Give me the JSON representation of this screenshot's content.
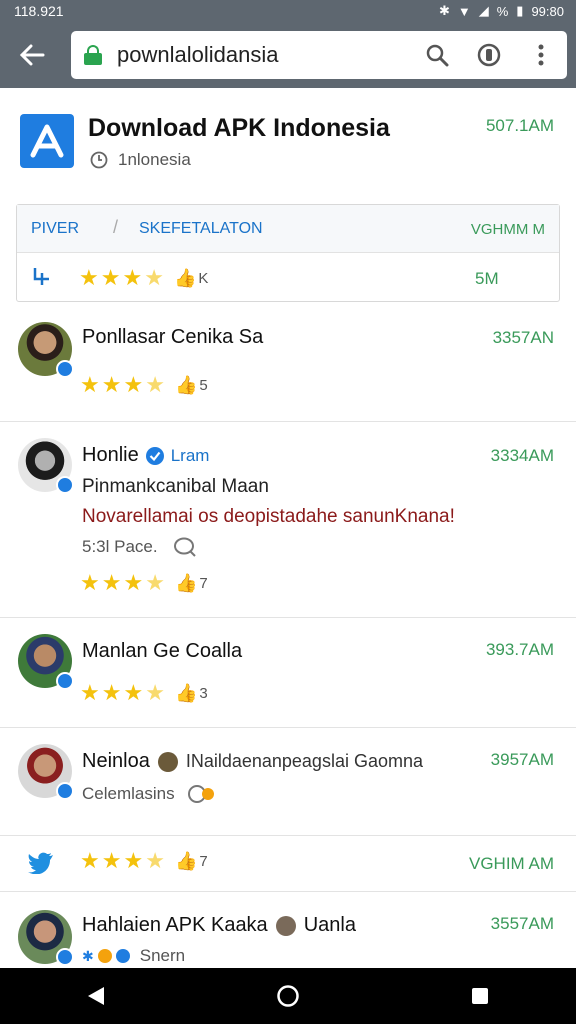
{
  "status_bar": {
    "left_text": "118.921",
    "right_text": "99:80",
    "percent": "%"
  },
  "url_bar": {
    "url": "pownlalolidansia"
  },
  "header": {
    "title": "Download APK Indonesia",
    "subtitle": "1nlonesia",
    "time": "507.1AM"
  },
  "filter": {
    "tab1": "PIVER",
    "sep": "/",
    "tab2": "SKEFETALATON",
    "time": "VGHMM M",
    "count": "K",
    "size": "5M"
  },
  "posts": [
    {
      "name": "Ponllasar Cenika Sa",
      "time": "3357AN",
      "count": "5"
    },
    {
      "name": "Honlie",
      "tag": "Lram",
      "time": "3334AM",
      "line1": "Pinmankcanibal Maan",
      "line2": "Novarellamai os deopistadahe sanunKnana!",
      "meta": "5:3l Pace.",
      "count": "7"
    },
    {
      "name": "Manlan Ge Coalla",
      "time": "393.7AM",
      "count": "3"
    },
    {
      "name": "Neinloa",
      "extra": "INaildaenanpeagslai Gaomna",
      "time": "3957AM",
      "meta": "Celemlasins"
    },
    {
      "time": "VGHIM AM",
      "count": "7"
    },
    {
      "name": "Hahlaien APK Kaaka",
      "extra": "Uanla",
      "time": "3557AM",
      "meta": "Snern"
    }
  ],
  "colors": {
    "toolbar": "#5e6770",
    "accent": "#1f7de0",
    "time_green": "#3a9a5a",
    "star": "#f4c20d",
    "highlight_red": "#8b1a1a"
  }
}
